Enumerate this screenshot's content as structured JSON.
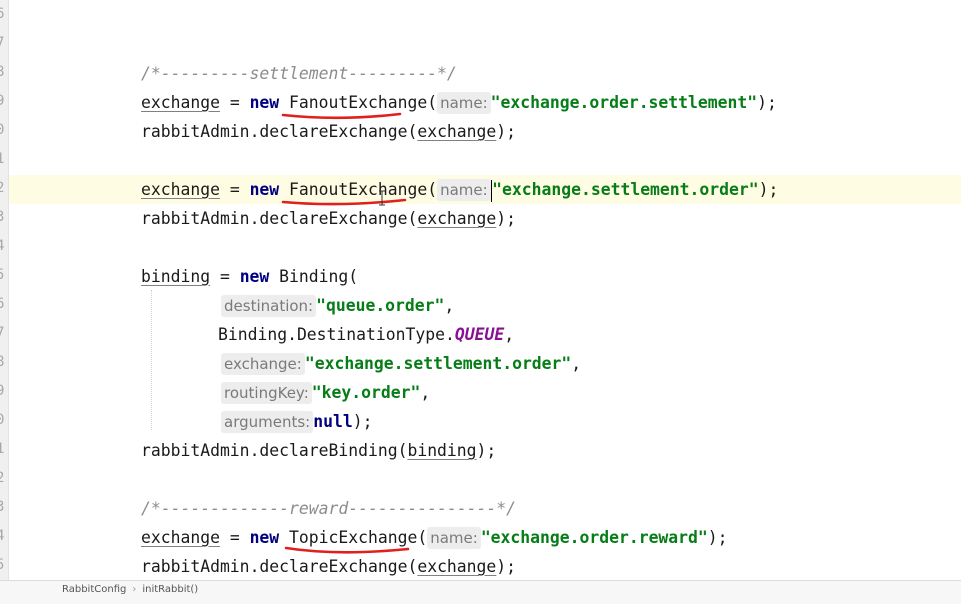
{
  "gutter": {
    "line_numbers": [
      "6",
      "7",
      "8",
      "9",
      "0",
      "1",
      "2",
      "3",
      "4",
      "5",
      "6",
      "7",
      "8",
      "9",
      "0",
      "1",
      "2",
      "3",
      "4",
      "5"
    ]
  },
  "code": {
    "comment_settlement": "/*---------settlement---------*/",
    "var_exchange": "exchange",
    "op_assign": " = ",
    "kw_new": "new",
    "cls_fanout": "FanoutExchange",
    "cls_topic": "TopicExchange",
    "cls_binding": "Binding",
    "paren_open": "(",
    "paren_close_semi": ");",
    "hint_name": "name:",
    "hint_destination": "destination:",
    "hint_exchange": "exchange:",
    "hint_routingKey": "routingKey:",
    "hint_arguments": "arguments:",
    "str_settlement": "\"exchange.order.settlement\"",
    "str_settlement_order": "\"exchange.settlement.order\"",
    "str_queue_order": "\"queue.order\"",
    "str_key_order": "\"key.order\"",
    "str_reward": "\"exchange.order.reward\"",
    "obj_rabbitAdmin": "rabbitAdmin",
    "method_declareExchange": ".declareExchange(",
    "method_declareBinding": ".declareBinding(",
    "var_binding": "binding",
    "dest_type_prefix": "Binding.DestinationType.",
    "field_queue": "QUEUE",
    "comma": ",",
    "kw_null": "null",
    "comment_reward": "/*-------------reward---------------*/"
  },
  "breadcrumb": {
    "class_name": "RabbitConfig",
    "method_name": "initRabbit()"
  },
  "colors": {
    "keyword": "#000080",
    "string": "#067d17",
    "comment": "#8c8c8c",
    "annotation_red": "#e0201c",
    "current_line": "#fffce4"
  }
}
